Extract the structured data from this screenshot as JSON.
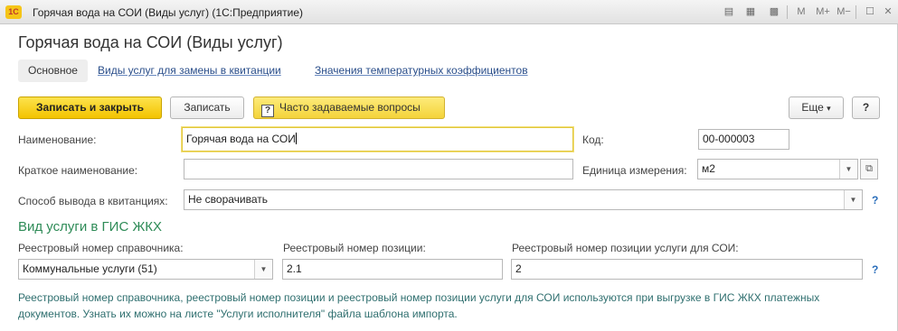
{
  "window": {
    "logo_text": "1С",
    "title": "Горячая вода на СОИ (Виды услуг)  (1С:Предприятие)",
    "toolbar": {
      "m_label": "M",
      "m_plus_label": "M+",
      "m_minus_label": "M−",
      "minimize": "—",
      "maximize": "☐",
      "close": "✕"
    }
  },
  "heading": "Горячая вода на СОИ (Виды услуг)",
  "tabs": [
    {
      "label": "Основное"
    },
    {
      "label": "Виды услуг для замены в квитанции"
    },
    {
      "label": "Значения температурных коэффициентов"
    }
  ],
  "commandbar": {
    "save_close": "Записать и закрыть",
    "save": "Записать",
    "faq": "Часто задаваемые вопросы",
    "more": "Еще",
    "more_arrow": "▾",
    "help": "?"
  },
  "fields": {
    "name": {
      "label": "Наименование:",
      "value": "Горячая вода на СОИ"
    },
    "code": {
      "label": "Код:",
      "value": "00-000003"
    },
    "short_name": {
      "label": "Краткое наименование:",
      "value": ""
    },
    "unit": {
      "label": "Единица измерения:",
      "value": "м2"
    },
    "output_mode": {
      "label": "Способ вывода в квитанциях:",
      "value": "Не сворачивать"
    }
  },
  "gis": {
    "section_title": "Вид услуги в ГИС ЖКХ",
    "registry_ref": {
      "label": "Реестровый номер справочника:",
      "value": "Коммунальные услуги (51)"
    },
    "registry_pos": {
      "label": "Реестровый номер позиции:",
      "value": "2.1"
    },
    "registry_pos_soi": {
      "label": "Реестровый номер позиции услуги для СОИ:",
      "value": "2"
    },
    "note_line1": "Реестровый номер справочника, реестровый номер позиции и реестровый номер позиции услуги для СОИ используются при выгрузке в ГИС ЖКХ платежных",
    "note_line2": "документов. Узнать их можно на листе \"Услуги исполнителя\" файла шаблона импорта."
  },
  "glyphs": {
    "dropdown": "▼",
    "help_mark": "?",
    "open": "⧉"
  }
}
